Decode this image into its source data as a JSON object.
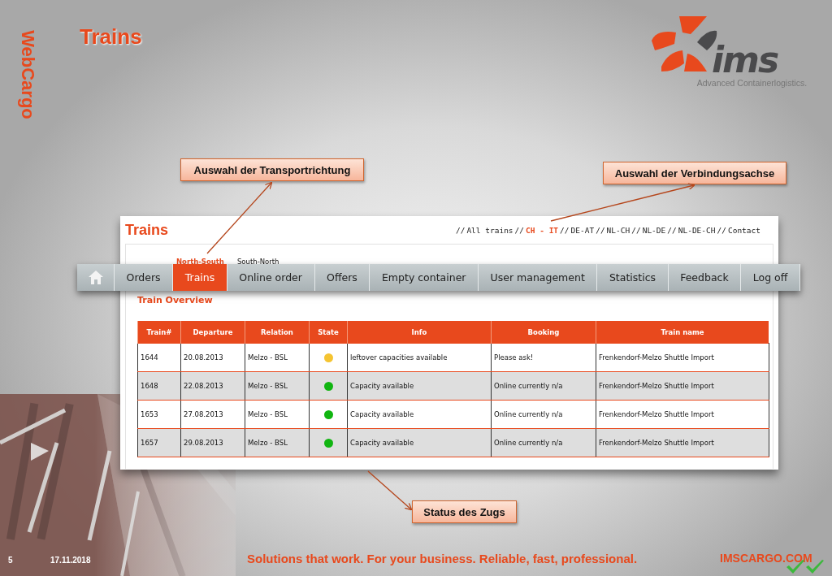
{
  "slide": {
    "side_label": "WebCargo",
    "title": "Trains",
    "logo_text": "ims",
    "logo_tagline": "Advanced Containerlogistics.",
    "page_number": "5",
    "date": "17.11.2018",
    "slogan": "Solutions that work. For your business. Reliable, fast, professional.",
    "website": "IMSCARGO.COM"
  },
  "callouts": [
    {
      "text": "Auswahl der Transportrichtung"
    },
    {
      "text": "Auswahl der Verbindungsachse"
    },
    {
      "text": "Status des Zugs"
    }
  ],
  "app": {
    "title": "Trains",
    "route_links": [
      {
        "kind": "sep",
        "text": "//"
      },
      {
        "kind": "link",
        "text": "All trains",
        "selected": false
      },
      {
        "kind": "sep",
        "text": "//"
      },
      {
        "kind": "link",
        "text": "CH - IT",
        "selected": true
      },
      {
        "kind": "sep",
        "text": "//"
      },
      {
        "kind": "link",
        "text": "DE-AT",
        "selected": false
      },
      {
        "kind": "sep",
        "text": "//"
      },
      {
        "kind": "link",
        "text": "NL-CH",
        "selected": false
      },
      {
        "kind": "sep",
        "text": "//"
      },
      {
        "kind": "link",
        "text": "NL-DE",
        "selected": false
      },
      {
        "kind": "sep",
        "text": "//"
      },
      {
        "kind": "link",
        "text": "NL-DE-CH",
        "selected": false
      },
      {
        "kind": "sep",
        "text": "//"
      },
      {
        "kind": "link",
        "text": "Contact",
        "selected": false
      }
    ],
    "directions": [
      {
        "label": "North-South",
        "selected": true
      },
      {
        "label": "South-North",
        "selected": false
      }
    ],
    "nav": [
      {
        "label": "Orders",
        "selected": false
      },
      {
        "label": "Trains",
        "selected": true
      },
      {
        "label": "Online order",
        "selected": false
      },
      {
        "label": "Offers",
        "selected": false
      },
      {
        "label": "Empty container",
        "selected": false
      },
      {
        "label": "User management",
        "selected": false
      },
      {
        "label": "Statistics",
        "selected": false
      },
      {
        "label": "Feedback",
        "selected": false
      },
      {
        "label": "Log off",
        "selected": false
      }
    ],
    "section_title": "Train Overview",
    "table": {
      "columns": [
        "Train#",
        "Departure",
        "Relation",
        "State",
        "Info",
        "Booking",
        "Train name"
      ],
      "rows": [
        {
          "train": "1644",
          "departure": "20.08.2013",
          "relation": "Melzo - BSL",
          "color": "#f5c431",
          "info": "leftover capacities available",
          "booking": "Please ask!",
          "train_name": "Frenkendorf-Melzo Shuttle Import"
        },
        {
          "train": "1648",
          "departure": "22.08.2013",
          "relation": "Melzo - BSL",
          "color": "#11b511",
          "info": "Capacity available",
          "booking": "Online currently n/a",
          "train_name": "Frenkendorf-Melzo Shuttle Import"
        },
        {
          "train": "1653",
          "departure": "27.08.2013",
          "relation": "Melzo - BSL",
          "color": "#11b511",
          "info": "Capacity available",
          "booking": "Online currently n/a",
          "train_name": "Frenkendorf-Melzo Shuttle Import"
        },
        {
          "train": "1657",
          "departure": "29.08.2013",
          "relation": "Melzo - BSL",
          "color": "#11b511",
          "info": "Capacity available",
          "booking": "Online currently n/a",
          "train_name": "Frenkendorf-Melzo Shuttle Import"
        }
      ]
    }
  }
}
